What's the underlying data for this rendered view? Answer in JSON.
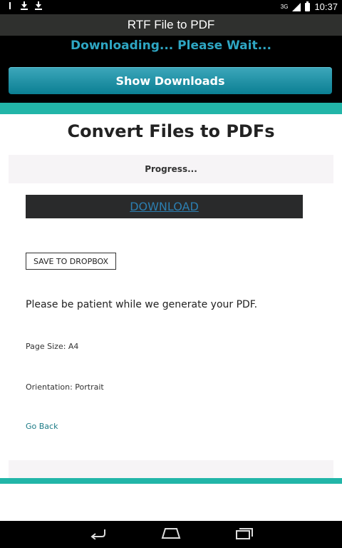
{
  "status_bar": {
    "left_icons": [
      "usb-icon",
      "download-icon",
      "download-icon"
    ],
    "network_label": "3G",
    "time": "10:37"
  },
  "app": {
    "title": "RTF File to PDF",
    "downloading_text": "Downloading... Please Wait...",
    "show_downloads_label": "Show Downloads"
  },
  "content": {
    "heading": "Convert Files to PDFs",
    "progress_label": "Progress...",
    "download_link": "DOWNLOAD",
    "dropbox_button": "SAVE TO DROPBOX",
    "patient_message": "Please be patient while we generate your PDF.",
    "page_size": "Page Size: A4",
    "orientation": "Orientation: Portrait",
    "go_back": "Go Back"
  },
  "nav_bar": {
    "buttons": [
      "back-icon",
      "home-icon",
      "recent-apps-icon"
    ]
  },
  "colors": {
    "accent_teal": "#22b5a8",
    "button_blue": "#0b7f93",
    "downloading_text": "#2ea6c3",
    "link": "#2c7eb0"
  }
}
